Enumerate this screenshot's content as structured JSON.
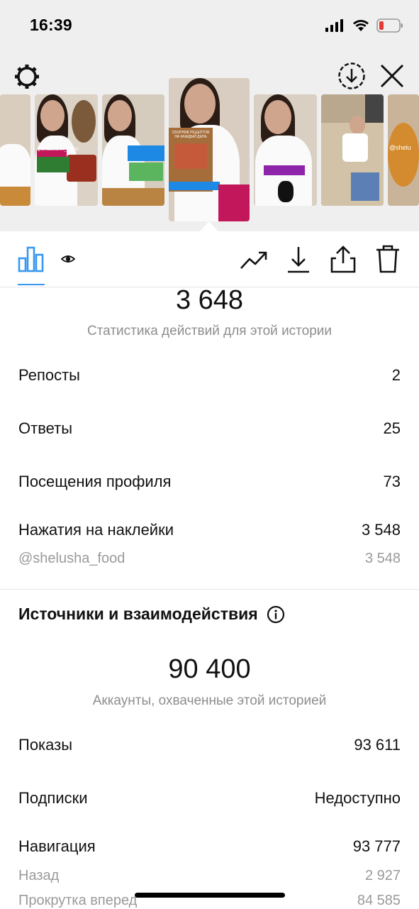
{
  "status_bar": {
    "time": "16:39"
  },
  "header": {
    "settings_icon": "gear-icon",
    "download_icon": "circle-download-icon",
    "close_icon": "close-icon"
  },
  "thumbnails": [
    {
      "caption": ""
    },
    {
      "caption": "@SHELUSHA_FOOD"
    },
    {
      "caption": ""
    },
    {
      "caption": "СБОРНИК РЕЦЕПТОВ НА КАЖДЫЙ ДЕНЬ"
    },
    {
      "caption": ""
    },
    {
      "caption": ""
    },
    {
      "caption": "@shelu"
    }
  ],
  "toolbar": {
    "stats_icon": "bar-chart-icon",
    "viewers_icon": "eye-icon",
    "promote_icon": "trending-up-icon",
    "save_icon": "download-icon",
    "share_icon": "share-icon",
    "delete_icon": "trash-icon"
  },
  "interactions": {
    "total": "3 648",
    "label": "Статистика действий для этой истории",
    "rows": [
      {
        "label": "Репосты",
        "value": "2"
      },
      {
        "label": "Ответы",
        "value": "25"
      },
      {
        "label": "Посещения профиля",
        "value": "73"
      },
      {
        "label": "Нажатия на наклейки",
        "value": "3 548"
      }
    ],
    "sticker": {
      "label": "@shelusha_food",
      "value": "3 548"
    }
  },
  "discovery": {
    "title": "Источники и взаимодействия",
    "info_icon": "info-icon",
    "total": "90 400",
    "label": "Аккаунты, охваченные этой историей",
    "rows": [
      {
        "label": "Показы",
        "value": "93 611"
      },
      {
        "label": "Подписки",
        "value": "Недоступно"
      },
      {
        "label": "Навигация",
        "value": "93 777"
      }
    ],
    "nav_rows": [
      {
        "label": "Назад",
        "value": "2 927"
      },
      {
        "label": "Прокрутка вперед",
        "value": "84 585"
      }
    ]
  },
  "colors": {
    "accent": "#3897f0",
    "header_bg": "#efefef",
    "muted": "#8e8e8e"
  }
}
